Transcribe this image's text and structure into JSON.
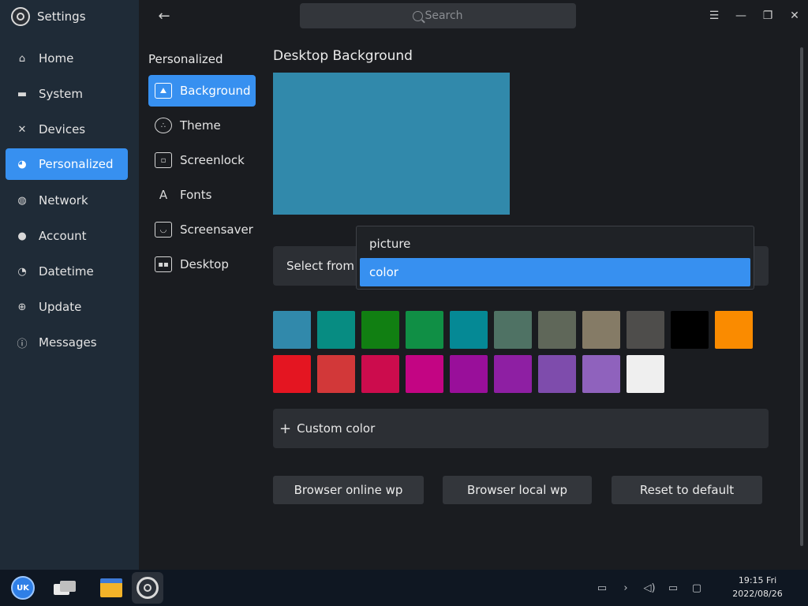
{
  "app": {
    "title": "Settings"
  },
  "sidebar": {
    "items": [
      {
        "label": "Home",
        "icon": "home-icon"
      },
      {
        "label": "System",
        "icon": "monitor-icon"
      },
      {
        "label": "Devices",
        "icon": "tools-icon"
      },
      {
        "label": "Personalized",
        "icon": "palette-icon",
        "active": true
      },
      {
        "label": "Network",
        "icon": "globe-icon"
      },
      {
        "label": "Account",
        "icon": "user-icon"
      },
      {
        "label": "Datetime",
        "icon": "clock-icon"
      },
      {
        "label": "Update",
        "icon": "update-icon"
      },
      {
        "label": "Messages",
        "icon": "info-icon"
      }
    ]
  },
  "header": {
    "search_placeholder": "Search"
  },
  "subnav": {
    "title": "Personalized",
    "items": [
      {
        "label": "Background",
        "icon": "image-icon",
        "active": true
      },
      {
        "label": "Theme",
        "icon": "palette-icon"
      },
      {
        "label": "Screenlock",
        "icon": "screenlock-icon"
      },
      {
        "label": "Fonts",
        "icon": "fonts-icon"
      },
      {
        "label": "Screensaver",
        "icon": "screensaver-icon"
      },
      {
        "label": "Desktop",
        "icon": "desktop-icon"
      }
    ]
  },
  "content": {
    "section_title": "Desktop Background",
    "preview_color": "#3189ab",
    "select_from_label": "Select from",
    "dropdown_options": [
      {
        "label": "picture",
        "selected": false
      },
      {
        "label": "color",
        "selected": true
      }
    ],
    "swatches_row1": [
      "#3189ab",
      "#078c82",
      "#117f12",
      "#108f45",
      "#058995",
      "#4f7264",
      "#5f6759",
      "#857b66",
      "#4e4d4b",
      "#000000",
      "#fa8b00"
    ],
    "swatches_row2": [
      "#e41521",
      "#d23839",
      "#cc0c4d",
      "#c30583",
      "#990f9a",
      "#8e1fa3",
      "#7e4cac",
      "#8f62bd",
      "#efefef"
    ],
    "custom_color_label": "Custom color",
    "buttons": {
      "online": "Browser online wp",
      "local": "Browser local wp",
      "reset": "Reset to default"
    }
  },
  "taskbar": {
    "start_label": "UK",
    "time": "19:15 Fri",
    "date": "2022/08/26"
  },
  "colors": {
    "accent": "#3790f0",
    "sidebar_bg": "#1f2b37",
    "main_bg": "#1a1c20",
    "taskbar_bg": "#0f1722"
  }
}
